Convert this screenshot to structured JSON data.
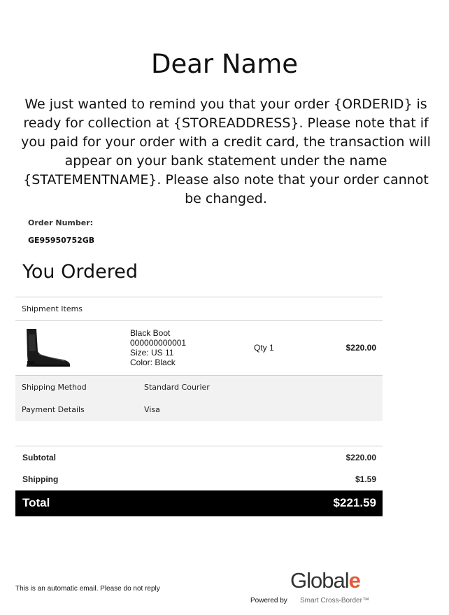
{
  "email": {
    "greeting": "Dear Name",
    "intro": "We just wanted to remind you that your order {ORDERID} is ready for collection at {STOREADDRESS}. Please note that if you paid for your order with a credit card, the transaction will appear on your bank statement under the name {STATEMENTNAME}. Please also note that your order cannot be changed."
  },
  "order": {
    "number_label": "Order Number:",
    "number": "GE95950752GB",
    "section_title": "You Ordered"
  },
  "shipment": {
    "title": "Shipment Items",
    "items": [
      {
        "name": "Black Boot",
        "sku": "000000000001",
        "size": "Size: US 11",
        "color": "Color: Black",
        "qty": "Qty 1",
        "price": "$220.00",
        "image": "black-chelsea-boot"
      }
    ],
    "details": [
      {
        "label": "Shipping Method",
        "value": "Standard Courier"
      },
      {
        "label": "Payment Details",
        "value": "Visa"
      }
    ]
  },
  "summary": {
    "subtotal_label": "Subtotal",
    "subtotal": "$220.00",
    "shipping_label": "Shipping",
    "shipping": "$1.59",
    "total_label": "Total",
    "total": "$221.59"
  },
  "footer": {
    "note": "This is an automatic email. Please do not reply",
    "powered_by": "Powered by",
    "logo_text": "Global",
    "logo_e": "e",
    "logo_tagline": "Smart Cross-Border™"
  },
  "colors": {
    "accent": "#e35a3a",
    "total_bar": "#000000",
    "details_bg": "#f2f2f2"
  }
}
